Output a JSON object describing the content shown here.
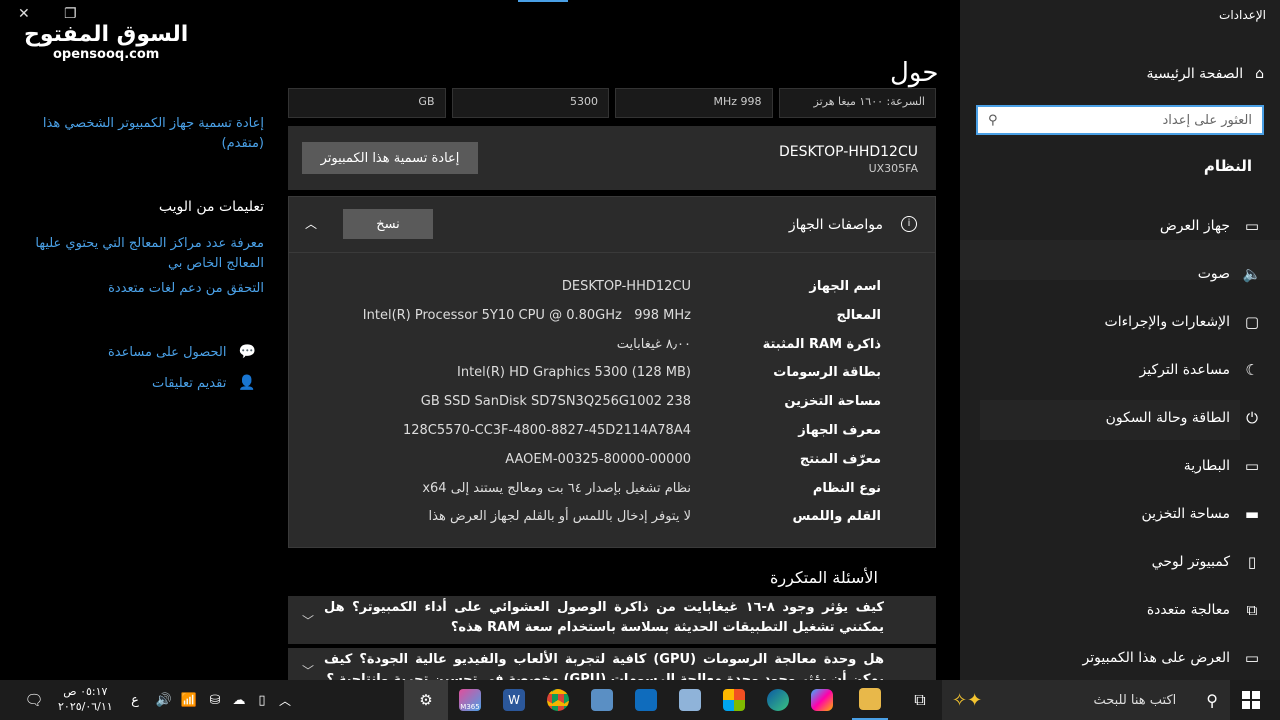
{
  "window": {
    "title": "الإعدادات",
    "close_glyph": "✕",
    "restore_glyph": "❐"
  },
  "watermark": {
    "arabic": "السوق المفتوح",
    "latin": "opensooq.com"
  },
  "nav": {
    "home": "الصفحة الرئيسية",
    "search_placeholder": "العثور على إعداد",
    "section": "النظام",
    "items": [
      {
        "label": "جهاز العرض",
        "icon": "display-icon",
        "glyph": "▭"
      },
      {
        "label": "صوت",
        "icon": "speaker-icon",
        "glyph": "🔈"
      },
      {
        "label": "الإشعارات والإجراءات",
        "icon": "notifications-icon",
        "glyph": "▢"
      },
      {
        "label": "مساعدة التركيز",
        "icon": "moon-icon",
        "glyph": "☾"
      },
      {
        "label": "الطاقة وحالة السكون",
        "icon": "power-icon",
        "glyph": "⏻"
      },
      {
        "label": "البطارية",
        "icon": "battery-icon",
        "glyph": "▭"
      },
      {
        "label": "مساحة التخزين",
        "icon": "storage-icon",
        "glyph": "▬"
      },
      {
        "label": "كمبيوتر لوحي",
        "icon": "tablet-icon",
        "glyph": "▯"
      },
      {
        "label": "معالجة متعددة",
        "icon": "multitasking-icon",
        "glyph": "⧉"
      },
      {
        "label": "العرض على هذا الكمبيوتر",
        "icon": "project-icon",
        "glyph": "▭"
      }
    ]
  },
  "main": {
    "title": "حول",
    "speeds": [
      "السرعة: ١٦٠٠ ميغا هرتز",
      "998 MHz",
      "5300",
      "GB"
    ],
    "device_name": "DESKTOP-HHD12CU",
    "model": "UX305FA",
    "rename_button": "إعادة تسمية هذا الكمبيوتر",
    "specs_title": "مواصفات الجهاز",
    "copy_button": "نسخ",
    "specs": [
      {
        "key": "اسم الجهاز",
        "value": "DESKTOP-HHD12CU"
      },
      {
        "key": "المعالج",
        "value": "Intel(R) Processor 5Y10 CPU @ 0.80GHz   998 MHz"
      },
      {
        "key": "ذاكرة RAM المثبتة",
        "value": "٨٫٠٠ غيغابايت"
      },
      {
        "key": "بطاقة الرسومات",
        "value": "Intel(R) HD Graphics 5300 (128 MB)"
      },
      {
        "key": "مساحة التخزين",
        "value": "238 GB SSD SanDisk SD7SN3Q256G1002"
      },
      {
        "key": "معرف الجهاز",
        "value": "128C5570-CC3F-4800-8827-45D2114A78A4"
      },
      {
        "key": "معرّف المنتج",
        "value": "00325-80000-00000-AAOEM"
      },
      {
        "key": "نوع النظام",
        "value": "نظام تشغيل بإصدار ٦٤ بت ومعالج يستند إلى x64"
      },
      {
        "key": "القلم واللمس",
        "value": "لا يتوفر إدخال باللمس أو بالقلم لجهاز العرض هذا"
      }
    ],
    "faq_title": "الأسئلة المتكررة",
    "faq": [
      "كيف يؤثر وجود ٨-١٦ غيغابايت من ذاكرة الوصول العشوائي على أداء الكمبيوتر؟ هل يمكنني تشغيل التطبيقات الحديثة بسلاسة باستخدام سعة RAM هذه؟",
      "هل وحدة معالجة الرسومات (GPU) كافية لتجربة الألعاب والفيديو عالية الجودة؟ كيف يمكن أن يؤثر وجود وحدة معالجة الرسومات (GPU) مخصصة في تحسين تجربة وإنتاجية ؟"
    ]
  },
  "side": {
    "rename_advanced": "إعادة تسمية جهاز الكمبيوتر الشخصي هذا (متقدم)",
    "web_help_title": "تعليمات من الويب",
    "web_links": [
      "معرفة عدد مراكز المعالج التي يحتوي عليها المعالج الخاص بي",
      "التحقق من دعم لغات متعددة"
    ],
    "get_help": "الحصول على مساعدة",
    "feedback": "تقديم تعليقات"
  },
  "taskbar": {
    "search_placeholder": "اكتب هنا للبحث",
    "time": "٠٥:١٧ ص",
    "date": "٢٠٢٥/٠٦/١١",
    "lang": "ع",
    "badge_m365": "M365"
  }
}
